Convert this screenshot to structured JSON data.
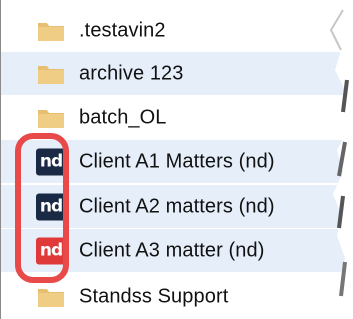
{
  "colors": {
    "folder": "#e8bf72",
    "row_shade": "#e5eef9",
    "nd_dark": "#1b2a44",
    "nd_red": "#e03939",
    "callout": "#e84a4a"
  },
  "items": [
    {
      "label": ".testavin2",
      "icon": "folder-icon"
    },
    {
      "label": "archive 123",
      "icon": "folder-icon"
    },
    {
      "label": "batch_OL",
      "icon": "folder-icon"
    },
    {
      "label": "Client A1 Matters (nd)",
      "icon": "nd-icon",
      "badge": "nd",
      "badge_color": "#1b2a44"
    },
    {
      "label": "Client A2 matters (nd)",
      "icon": "nd-icon",
      "badge": "nd",
      "badge_color": "#1b2a44"
    },
    {
      "label": "Client A3 matter (nd)",
      "icon": "nd-icon",
      "badge": "nd",
      "badge_color": "#e03939"
    },
    {
      "label": "Standss Support",
      "icon": "folder-icon"
    }
  ]
}
